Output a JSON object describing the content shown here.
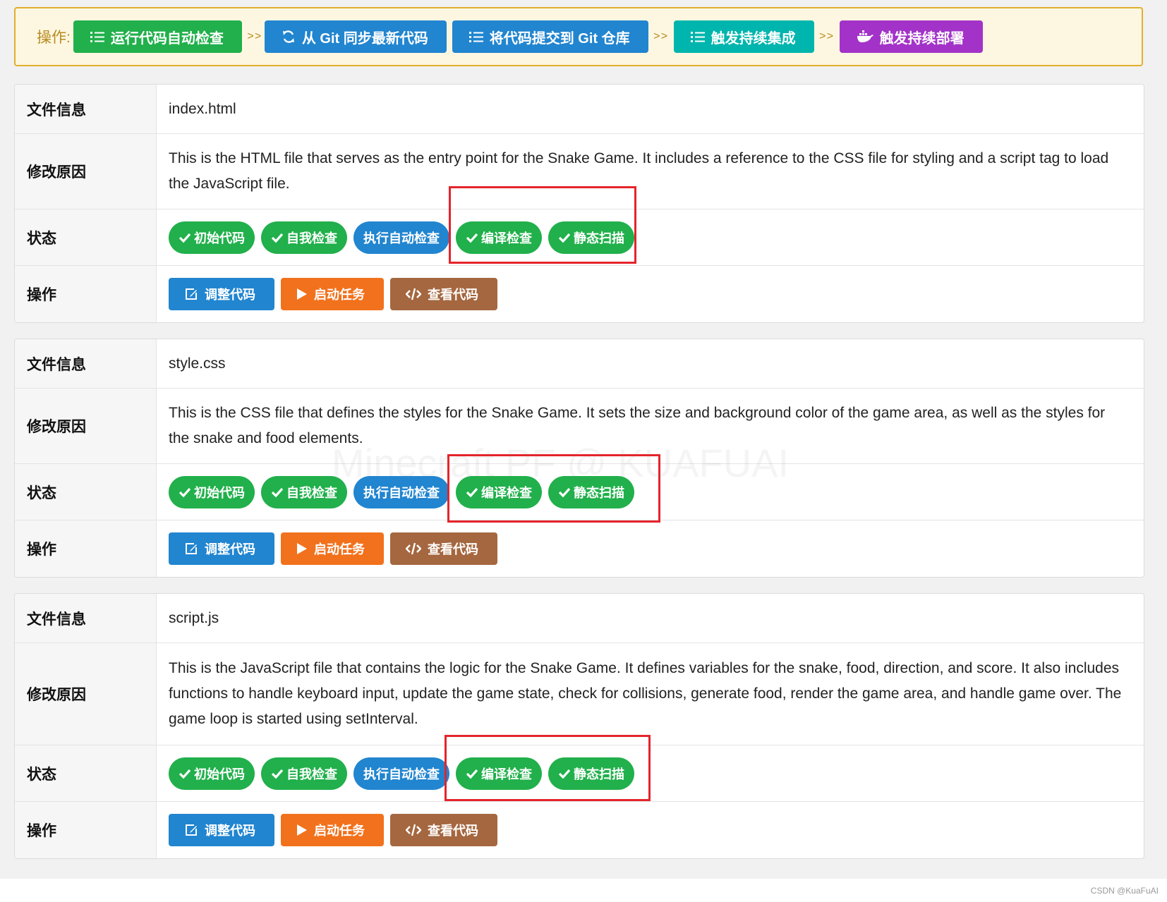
{
  "toolbar": {
    "label": "操作:",
    "separator": ">>",
    "buttons": [
      {
        "label": "运行代码自动检查",
        "icon": "list-check-icon",
        "color": "#21b04b"
      },
      {
        "label": "从 Git 同步最新代码",
        "icon": "sync-icon",
        "color": "#2185d0"
      },
      {
        "label": "将代码提交到 Git 仓库",
        "icon": "list-check-icon",
        "color": "#2185d0"
      },
      {
        "label": "触发持续集成",
        "icon": "list-check-icon",
        "color": "#00b5ad"
      },
      {
        "label": "触发持续部署",
        "icon": "docker-icon",
        "color": "#a333c8"
      }
    ]
  },
  "labels": {
    "file_info": "文件信息",
    "reason": "修改原因",
    "status": "状态",
    "actions": "操作"
  },
  "status_badges": [
    {
      "label": "初始代码",
      "checked": true,
      "color": "#21b04b"
    },
    {
      "label": "自我检查",
      "checked": true,
      "color": "#21b04b"
    },
    {
      "label": "执行自动检查",
      "checked": false,
      "color": "#2185d0"
    },
    {
      "label": "编译检查",
      "checked": true,
      "color": "#21b04b"
    },
    {
      "label": "静态扫描",
      "checked": true,
      "color": "#21b04b"
    }
  ],
  "action_buttons": [
    {
      "label": "调整代码",
      "icon": "edit-icon",
      "color": "#2185d0"
    },
    {
      "label": "启动任务",
      "icon": "play-icon",
      "color": "#f2711c"
    },
    {
      "label": "查看代码",
      "icon": "code-icon",
      "color": "#a5673f"
    }
  ],
  "files": [
    {
      "name": "index.html",
      "reason": "This is the HTML file that serves as the entry point for the Snake Game. It includes a reference to the CSS file for styling and a script tag to load the JavaScript file."
    },
    {
      "name": "style.css",
      "reason": "This is the CSS file that defines the styles for the Snake Game. It sets the size and background color of the game area, as well as the styles for the snake and food elements."
    },
    {
      "name": "script.js",
      "reason": "This is the JavaScript file that contains the logic for the Snake Game. It defines variables for the snake, food, direction, and score. It also includes functions to handle keyboard input, update the game state, check for collisions, generate food, render the game area, and handle game over. The game loop is started using setInterval."
    }
  ],
  "watermark": "Minecraft PF @ KUAFUAI",
  "credit": "CSDN @KuaFuAI"
}
